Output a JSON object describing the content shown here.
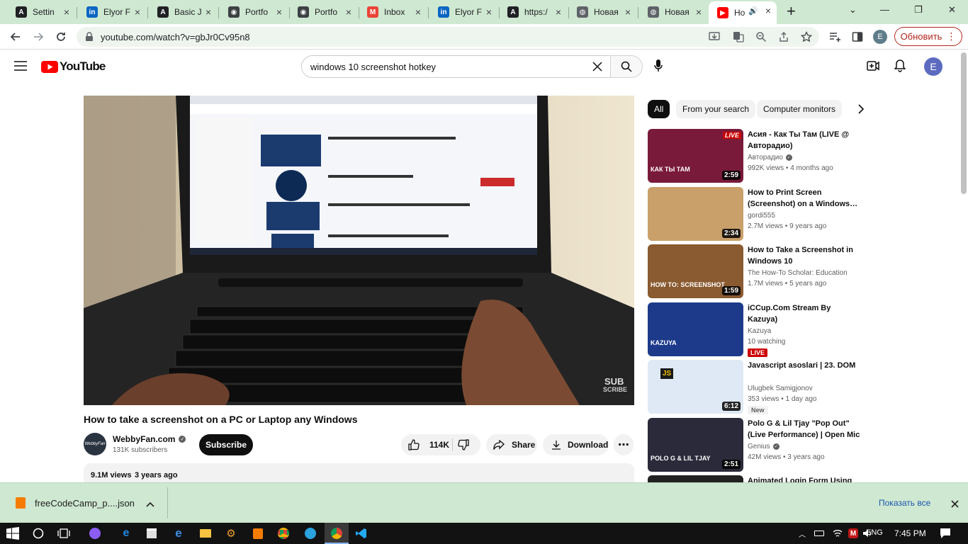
{
  "browser": {
    "tabs": [
      {
        "label": "Settin",
        "favicon": "A",
        "color": "#202124"
      },
      {
        "label": "Elyor F",
        "favicon": "in",
        "color": "#0a66c2"
      },
      {
        "label": "Basic J",
        "favicon": "A",
        "color": "#202124"
      },
      {
        "label": "Portfo",
        "favicon": "◉",
        "color": "#3c4043"
      },
      {
        "label": "Portfo",
        "favicon": "◉",
        "color": "#3c4043"
      },
      {
        "label": "Inbox",
        "favicon": "M",
        "color": "#ea4335"
      },
      {
        "label": "Elyor F",
        "favicon": "in",
        "color": "#0a66c2"
      },
      {
        "label": "https:/",
        "favicon": "A",
        "color": "#202124"
      },
      {
        "label": "Новая",
        "favicon": "◍",
        "color": "#5f6368"
      },
      {
        "label": "Новая",
        "favicon": "◍",
        "color": "#5f6368"
      },
      {
        "label": "Но",
        "favicon": "▶",
        "color": "#ff0000"
      }
    ],
    "new_tab": "+",
    "url": "youtube.com/watch?v=gbJr0Cv95n8",
    "profile_initial": "E",
    "update_label": "Обновить"
  },
  "youtube": {
    "logo_text": "YouTube",
    "search_value": "windows 10 screenshot hotkey",
    "avatar_initial": "E",
    "video": {
      "title": "How to take a screenshot on a PC or Laptop any Windows",
      "channel": "WebbyFan.com",
      "subscribers": "131K subscribers",
      "subscribe_label": "Subscribe",
      "likes": "114K",
      "share_label": "Share",
      "download_label": "Download",
      "views": "9.1M views",
      "age": "3 years ago",
      "watermark": "SUB\nSCRIBE"
    },
    "chips": [
      "All",
      "From your search",
      "Computer monitors"
    ],
    "recommendations": [
      {
        "title": "Асия - Как Ты Там (LIVE @ Авторадио)",
        "channel": "Авторадио",
        "verified": true,
        "meta": "992K views • 4 months ago",
        "duration": "2:59",
        "thumb": "#7a1a3a",
        "thumb_text": "КАК ТЫ ТАМ",
        "live_corner": "LIVE"
      },
      {
        "title": "How to Print Screen (Screenshot) on a Windows…",
        "channel": "gordi555",
        "verified": false,
        "meta": "2.7M views • 9 years ago",
        "duration": "2:34",
        "thumb": "#c9a06a",
        "thumb_text": ""
      },
      {
        "title": "How to Take a Screenshot in Windows 10",
        "channel": "The How-To Scholar: Education",
        "verified": false,
        "meta": "1.7M views • 5 years ago",
        "duration": "1:59",
        "thumb": "#8a5a30",
        "thumb_text": "HOW TO: SCREENSHOT"
      },
      {
        "title": "iCCup.Com Stream By Kazuya)",
        "channel": "Kazuya",
        "verified": false,
        "meta": "10 watching",
        "duration": "",
        "thumb": "#1d3a8a",
        "thumb_text": "KAZUYA",
        "live": "LIVE"
      },
      {
        "title": "Javascript asoslari | 23. DOM",
        "channel": "Ulugbek Samigjonov",
        "verified": false,
        "meta": "353 views • 1 day ago",
        "duration": "6:12",
        "thumb": "#dfe9f5",
        "thumb_text": "JS",
        "badge": "New"
      },
      {
        "title": "Polo G & Lil Tjay \"Pop Out\" (Live Performance) | Open Mic",
        "channel": "Genius",
        "verified": true,
        "meta": "42M views • 3 years ago",
        "duration": "2:51",
        "thumb": "#2a2a3a",
        "thumb_text": "POLO G & LIL TJAY"
      },
      {
        "title": "Animated Login Form Using",
        "channel": "",
        "verified": false,
        "meta": "",
        "duration": "",
        "thumb": "#222222",
        "thumb_text": ""
      }
    ]
  },
  "downloads": {
    "file": "freeCodeCamp_p....json",
    "show_all": "Показать все"
  },
  "taskbar": {
    "lang": "ENG",
    "time": "7:45 PM"
  }
}
